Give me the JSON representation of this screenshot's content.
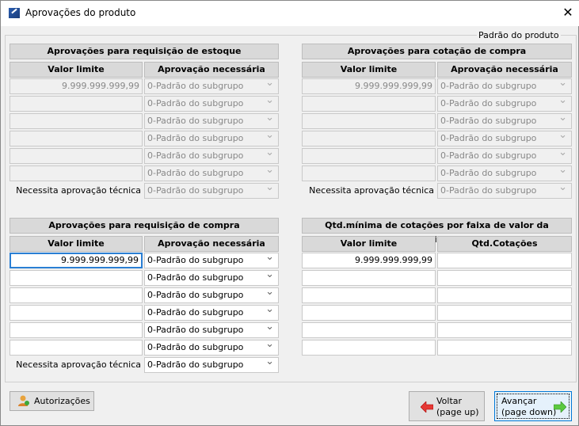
{
  "window": {
    "title": "Aprovações do produto",
    "close": "✕"
  },
  "legend": "Padrão do produto",
  "sections": {
    "estoque": {
      "title": "Aprovações para requisição de estoque",
      "col1": "Valor limite",
      "col2": "Aprovação necessária",
      "rows": [
        {
          "v": "9.999.999.999,99",
          "a": "0-Padrão do subgrupo"
        },
        {
          "v": "",
          "a": "0-Padrão do subgrupo"
        },
        {
          "v": "",
          "a": "0-Padrão do subgrupo"
        },
        {
          "v": "",
          "a": "0-Padrão do subgrupo"
        },
        {
          "v": "",
          "a": "0-Padrão do subgrupo"
        },
        {
          "v": "",
          "a": "0-Padrão do subgrupo"
        }
      ],
      "tecnica_label": "Necessita aprovação técnica",
      "tecnica_value": "0-Padrão do subgrupo"
    },
    "cotacao": {
      "title": "Aprovações para cotação de compra",
      "col1": "Valor limite",
      "col2": "Aprovação necessária",
      "rows": [
        {
          "v": "9.999.999.999,99",
          "a": "0-Padrão do subgrupo"
        },
        {
          "v": "",
          "a": "0-Padrão do subgrupo"
        },
        {
          "v": "",
          "a": "0-Padrão do subgrupo"
        },
        {
          "v": "",
          "a": "0-Padrão do subgrupo"
        },
        {
          "v": "",
          "a": "0-Padrão do subgrupo"
        },
        {
          "v": "",
          "a": "0-Padrão do subgrupo"
        }
      ],
      "tecnica_label": "Necessita aprovação técnica",
      "tecnica_value": "0-Padrão do subgrupo"
    },
    "compra": {
      "title": "Aprovações para requisição de compra",
      "col1": "Valor limite",
      "col2": "Aprovação necessária",
      "rows": [
        {
          "v": "9.999.999.999,99",
          "a": "0-Padrão do subgrupo"
        },
        {
          "v": "",
          "a": "0-Padrão do subgrupo"
        },
        {
          "v": "",
          "a": "0-Padrão do subgrupo"
        },
        {
          "v": "",
          "a": "0-Padrão do subgrupo"
        },
        {
          "v": "",
          "a": "0-Padrão do subgrupo"
        },
        {
          "v": "",
          "a": "0-Padrão do subgrupo"
        }
      ],
      "tecnica_label": "Necessita aprovação técnica",
      "tecnica_value": "0-Padrão do subgrupo"
    },
    "qtd": {
      "title": "Qtd.mínima de cotações por faixa de valor da requisição",
      "col1": "Valor limite",
      "col2": "Qtd.Cotações",
      "rows": [
        {
          "v": "9.999.999.999,99",
          "a": ""
        },
        {
          "v": "",
          "a": ""
        },
        {
          "v": "",
          "a": ""
        },
        {
          "v": "",
          "a": ""
        },
        {
          "v": "",
          "a": ""
        },
        {
          "v": "",
          "a": ""
        }
      ]
    }
  },
  "buttons": {
    "autorizacoes": "Autorizações",
    "voltar_line1": "Voltar",
    "voltar_line2": "(page up)",
    "avancar_line1": "Avançar",
    "avancar_line2": "(page down)"
  }
}
